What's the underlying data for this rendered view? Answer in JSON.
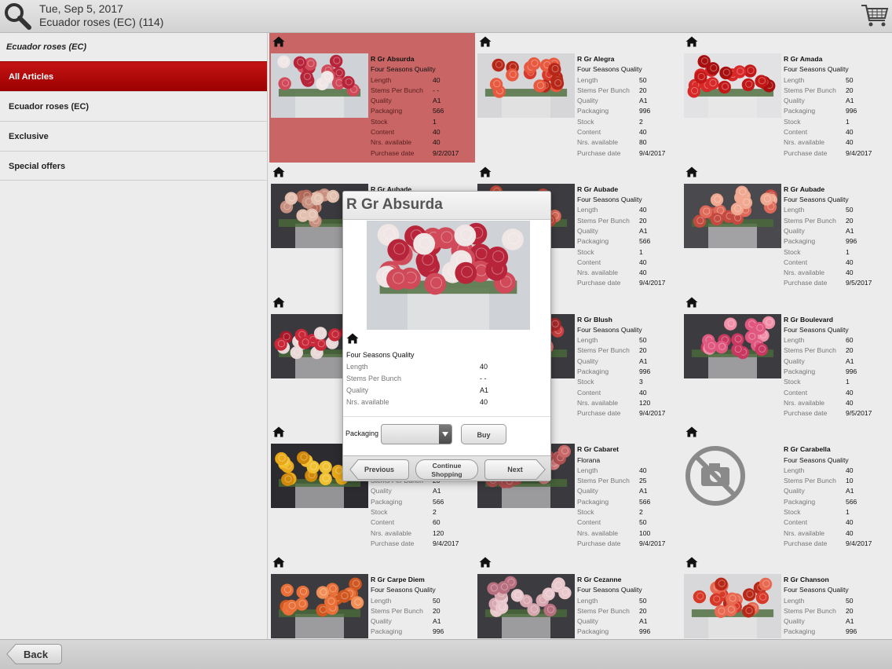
{
  "header": {
    "date": "Tue, Sep 5, 2017",
    "title": "Ecuador roses (EC) (114)"
  },
  "sidebar": {
    "section": "Ecuador roses (EC)",
    "items": [
      {
        "label": "All Articles",
        "active": true
      },
      {
        "label": "Ecuador roses (EC)"
      },
      {
        "label": "Exclusive"
      },
      {
        "label": "Special offers"
      }
    ]
  },
  "labels": {
    "length": "Length",
    "stems": "Stems Per Bunch",
    "quality": "Quality",
    "packaging": "Packaging",
    "stock": "Stock",
    "content": "Content",
    "available": "Nrs. available",
    "purchase": "Purchase date"
  },
  "products": [
    {
      "name": "R Gr Absurda",
      "sub": "Four Seasons Quality",
      "length": "40",
      "stems": "- -",
      "quality": "A1",
      "packaging": "566",
      "stock": "1",
      "content": "40",
      "available": "40",
      "purchase": "9/2/2017"
    },
    {
      "name": "R Gr Alegra",
      "sub": "Four Seasons Quality",
      "length": "50",
      "stems": "20",
      "quality": "A1",
      "packaging": "996",
      "stock": "2",
      "content": "40",
      "available": "80",
      "purchase": "9/4/2017"
    },
    {
      "name": "R Gr Amada",
      "sub": "Four Seasons Quality",
      "length": "50",
      "stems": "20",
      "quality": "A1",
      "packaging": "996",
      "stock": "1",
      "content": "40",
      "available": "40",
      "purchase": "9/4/2017"
    },
    {
      "name": "R Gr Aubade",
      "sub": "",
      "length": "",
      "stems": "",
      "quality": "",
      "packaging": "",
      "stock": "",
      "content": "",
      "available": "",
      "purchase": ""
    },
    {
      "name": "R Gr Aubade",
      "sub": "Four Seasons Quality",
      "length": "40",
      "stems": "20",
      "quality": "A1",
      "packaging": "566",
      "stock": "1",
      "content": "40",
      "available": "40",
      "purchase": "9/4/2017"
    },
    {
      "name": "R Gr Aubade",
      "sub": "Four Seasons Quality",
      "length": "50",
      "stems": "20",
      "quality": "A1",
      "packaging": "996",
      "stock": "1",
      "content": "40",
      "available": "40",
      "purchase": "9/5/2017"
    },
    {
      "name": "",
      "sub": "",
      "length": "",
      "stems": "",
      "quality": "",
      "packaging": "",
      "stock": "",
      "content": "",
      "available": "",
      "purchase": ""
    },
    {
      "name": "R Gr Blush",
      "sub": "Four Seasons Quality",
      "length": "50",
      "stems": "20",
      "quality": "A1",
      "packaging": "996",
      "stock": "3",
      "content": "40",
      "available": "120",
      "purchase": "9/4/2017"
    },
    {
      "name": "R Gr Boulevard",
      "sub": "Four Seasons Quality",
      "length": "60",
      "stems": "20",
      "quality": "A1",
      "packaging": "996",
      "stock": "1",
      "content": "40",
      "available": "40",
      "purchase": "9/5/2017"
    },
    {
      "name": "",
      "sub": "",
      "length": "",
      "stems": "20",
      "quality": "A1",
      "packaging": "566",
      "stock": "2",
      "content": "60",
      "available": "120",
      "purchase": "9/4/2017"
    },
    {
      "name": "R Gr Cabaret",
      "sub": "Florana",
      "length": "40",
      "stems": "25",
      "quality": "A1",
      "packaging": "566",
      "stock": "2",
      "content": "50",
      "available": "100",
      "purchase": "9/4/2017"
    },
    {
      "name": "R Gr Carabella",
      "sub": "Four Seasons Quality",
      "length": "40",
      "stems": "10",
      "quality": "A1",
      "packaging": "566",
      "stock": "1",
      "content": "40",
      "available": "40",
      "purchase": "9/4/2017"
    },
    {
      "name": "R Gr Carpe Diem",
      "sub": "Four Seasons Quality",
      "length": "50",
      "stems": "20",
      "quality": "A1",
      "packaging": "996",
      "stock": "",
      "content": "",
      "available": "",
      "purchase": ""
    },
    {
      "name": "R Gr Cezanne",
      "sub": "Four Seasons Quality",
      "length": "50",
      "stems": "20",
      "quality": "A1",
      "packaging": "996",
      "stock": "",
      "content": "",
      "available": "",
      "purchase": ""
    },
    {
      "name": "R Gr Chanson",
      "sub": "Four Seasons Quality",
      "length": "50",
      "stems": "20",
      "quality": "A1",
      "packaging": "996",
      "stock": "",
      "content": "",
      "available": "",
      "purchase": ""
    }
  ],
  "popup": {
    "title": "R Gr Absurda",
    "sub": "Four Seasons Quality",
    "rows": [
      {
        "label": "Length",
        "value": "40"
      },
      {
        "label": "Stems Per Bunch",
        "value": "- -"
      },
      {
        "label": "Quality",
        "value": "A1"
      },
      {
        "label": "Nrs. available",
        "value": "40"
      }
    ],
    "packaging_label": "Packaging",
    "buy": "Buy",
    "previous": "Previous",
    "continue_line1": "Continue",
    "continue_line2": "Shopping",
    "next": "Next"
  },
  "footer": {
    "back": "Back"
  },
  "colors": {
    "accent_red": "#b00000",
    "selected_card": "#c96565"
  }
}
